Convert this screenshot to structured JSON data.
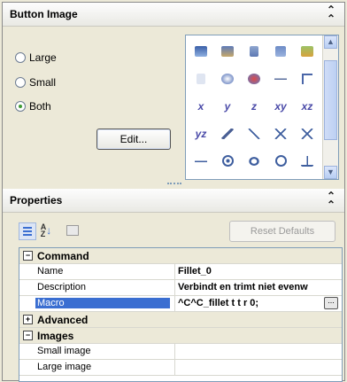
{
  "button_image": {
    "title": "Button Image",
    "radios": [
      {
        "label": "Large",
        "selected": false
      },
      {
        "label": "Small",
        "selected": false
      },
      {
        "label": "Both",
        "selected": true
      }
    ],
    "edit_label": "Edit...",
    "text_icons": {
      "x": "x",
      "y": "y",
      "z": "z",
      "xy": "xy",
      "xz": "xz",
      "yz": "yz"
    }
  },
  "properties": {
    "title": "Properties",
    "reset_label": "Reset Defaults",
    "categories": {
      "command": "Command",
      "advanced": "Advanced",
      "images": "Images"
    },
    "rows": {
      "name": {
        "key": "Name",
        "value": "Fillet_0"
      },
      "description": {
        "key": "Description",
        "value": "Verbindt en trimt niet evenw"
      },
      "macro": {
        "key": "Macro",
        "value": "^C^C_fillet t t r 0;"
      },
      "small_image": {
        "key": "Small image",
        "value": ""
      },
      "large_image": {
        "key": "Large image",
        "value": ""
      }
    },
    "expand": {
      "command": "−",
      "advanced": "+",
      "images": "−"
    }
  },
  "colors": {
    "selection": "#3a6ed1",
    "panel": "#ece9d8",
    "accent_green": "#3f9b35"
  }
}
